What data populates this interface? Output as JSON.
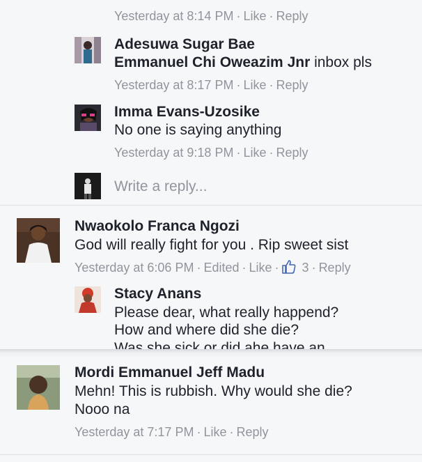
{
  "top_meta": {
    "time": "Yesterday at 8:14 PM",
    "like": "Like",
    "reply": "Reply",
    "sep": "·"
  },
  "replies": [
    {
      "author": "Adesuwa Sugar Bae",
      "mention": "Emmanuel Chi Oweazim Jnr",
      "text": " inbox pls",
      "time": "Yesterday at 8:17 PM",
      "like": "Like",
      "reply": "Reply"
    },
    {
      "author": "Imma Evans-Uzosike",
      "text": "No one is saying anything",
      "time": "Yesterday at 9:18 PM",
      "like": "Like",
      "reply": "Reply"
    }
  ],
  "write_reply": {
    "placeholder": "Write a reply..."
  },
  "comments": [
    {
      "author": "Nwaokolo Franca Ngozi",
      "text": "God will really fight for you . Rip sweet sist",
      "time": "Yesterday at 6:06 PM",
      "edited": "Edited",
      "like": "Like",
      "like_count": "3",
      "reply": "Reply",
      "nested": {
        "author": "Stacy Anans",
        "lines": [
          "Please dear, what really happend?",
          "How and where did she die?",
          "Was she sick or did ahe have an"
        ]
      }
    },
    {
      "author": "Mordi Emmanuel Jeff Madu",
      "lines": [
        "Mehn! This is rubbish. Why would she die?",
        "Nooo na"
      ],
      "time": "Yesterday at 7:17 PM",
      "like": "Like",
      "reply": "Reply"
    }
  ],
  "colors": {
    "meta": "#90949c",
    "text": "#1d2129",
    "like_blue": "#4267b2"
  }
}
